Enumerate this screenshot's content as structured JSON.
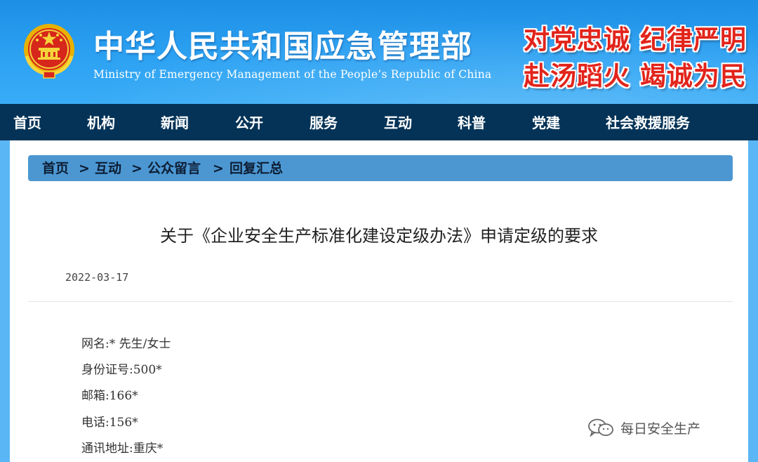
{
  "header": {
    "title_cn": "中华人民共和国应急管理部",
    "title_en": "Ministry of Emergency Management of the People’s Republic of China",
    "slogan_line1": "对党忠诚 纪律严明",
    "slogan_line2": "赴汤蹈火 竭诚为民",
    "emblem_icon": "national-emblem-icon"
  },
  "nav": {
    "items": [
      "首页",
      "机构",
      "新闻",
      "公开",
      "服务",
      "互动",
      "科普",
      "党建",
      "社会救援服务"
    ]
  },
  "breadcrumb": {
    "items": [
      "首页",
      "互动",
      "公众留言",
      "回复汇总"
    ],
    "separator": ">"
  },
  "article": {
    "title": "关于《企业安全生产标准化建设定级办法》申请定级的要求",
    "date": "2022-03-17",
    "fields": {
      "net_name": "网名:* 先生/女士",
      "id_number": "身份证号:500*",
      "email": "邮箱:166*",
      "phone": "电话:156*",
      "address": "通讯地址:重庆*"
    }
  },
  "watermark": {
    "text": "每日安全生产",
    "icon": "wechat-icon"
  },
  "colors": {
    "header_blue": "#2ea3f3",
    "nav_dark": "#043357",
    "breadcrumb_blue": "#4c97d2",
    "slogan_red": "#e2241b"
  }
}
